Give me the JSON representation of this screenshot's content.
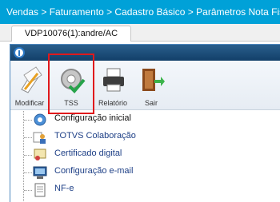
{
  "breadcrumb": "Vendas > Faturamento > Cadastro Básico > Parâmetros Nota Fiscal E",
  "tab": {
    "label": "VDP10076(1):andre/AC"
  },
  "toolbar": {
    "modify": "Modificar",
    "tss": "TSS",
    "report": "Relatório",
    "exit": "Sair"
  },
  "tree": {
    "items": [
      {
        "label": "Configuração inicial",
        "icon": "gear-icon"
      },
      {
        "label": "TOTVS Colaboração",
        "icon": "collaboration-icon"
      },
      {
        "label": "Certificado digital",
        "icon": "certificate-icon"
      },
      {
        "label": "Configuração e-mail",
        "icon": "monitor-icon"
      },
      {
        "label": "NF-e",
        "icon": "document-icon"
      }
    ]
  },
  "colors": {
    "breadcrumb_bg": "#00a1d8",
    "highlight": "#e0191c",
    "link": "#1d3f86"
  }
}
